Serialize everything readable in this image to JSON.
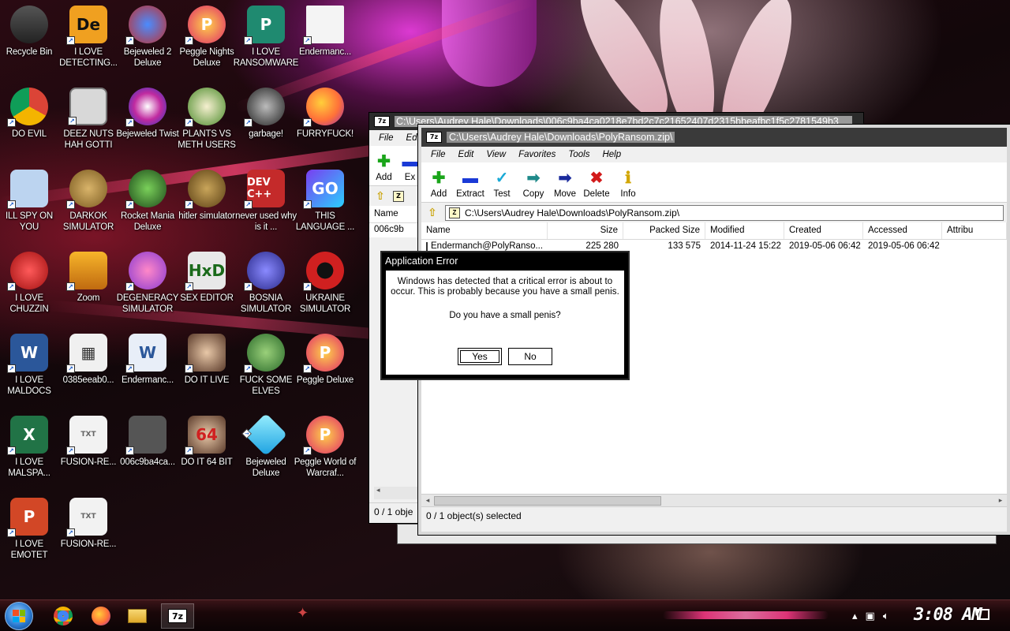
{
  "desktop": {
    "icons": [
      {
        "label": "Recycle Bin",
        "glyph": "trash-icon"
      },
      {
        "label": "I LOVE DETECTING...",
        "glyph": "de-icon"
      },
      {
        "label": "Bejeweled 2 Deluxe",
        "glyph": "bejeweled2-icon"
      },
      {
        "label": "Peggle Nights Deluxe",
        "glyph": "peggle-icon"
      },
      {
        "label": "I LOVE RANSOMWARE",
        "glyph": "publisher-icon"
      },
      {
        "label": "Endermanc...",
        "glyph": "blank-file-icon"
      },
      {
        "label": "DO EVIL",
        "glyph": "chrome-icon"
      },
      {
        "label": "DEEZ NUTS HAH GOTTI",
        "glyph": "windows-stack-icon"
      },
      {
        "label": "Bejeweled Twist",
        "glyph": "bejeweled-twist-icon"
      },
      {
        "label": "PLANTS VS METH USERS",
        "glyph": "plants-icon"
      },
      {
        "label": "garbage!",
        "glyph": "garbage-icon"
      },
      {
        "label": "FURRYFUCK!",
        "glyph": "firefox-icon"
      },
      {
        "label": "ILL SPY ON YOU",
        "glyph": "spy-icon"
      },
      {
        "label": "DARKOK SIMULATOR",
        "glyph": "moneybag-icon"
      },
      {
        "label": "Rocket Mania Deluxe",
        "glyph": "rocket-icon"
      },
      {
        "label": "hitler simulator",
        "glyph": "coin-icon"
      },
      {
        "label": "never used why is it ...",
        "glyph": "devcpp-icon"
      },
      {
        "label": "THIS LANGUAGE ...",
        "glyph": "goland-icon"
      },
      {
        "label": "I LOVE CHUZZIN",
        "glyph": "chuzzle-icon"
      },
      {
        "label": "Zoom",
        "glyph": "zoom-icon"
      },
      {
        "label": "DEGENERACY SIMULATOR",
        "glyph": "gender-icon"
      },
      {
        "label": "SEX EDITOR",
        "glyph": "hxd-icon"
      },
      {
        "label": "BOSNIA SIMULATOR",
        "glyph": "mine-icon"
      },
      {
        "label": "UKRAINE SIMULATOR",
        "glyph": "radiation-icon"
      },
      {
        "label": "I LOVE MALDOCS",
        "glyph": "word-icon"
      },
      {
        "label": "0385eeab0...",
        "glyph": "building-icon"
      },
      {
        "label": "Endermanc...",
        "glyph": "word-doc-icon"
      },
      {
        "label": "DO IT LIVE",
        "glyph": "portrait-icon"
      },
      {
        "label": "FUCK SOME ELVES",
        "glyph": "elf-icon"
      },
      {
        "label": "Peggle Deluxe",
        "glyph": "peggle-icon"
      },
      {
        "label": "I LOVE MALSPA...",
        "glyph": "excel-icon"
      },
      {
        "label": "FUSION-RE...",
        "glyph": "txt-file-icon"
      },
      {
        "label": "006c9ba4ca...",
        "glyph": "video-file-icon"
      },
      {
        "label": "DO IT 64 BIT",
        "glyph": "portrait64-icon"
      },
      {
        "label": "Bejeweled Deluxe",
        "glyph": "diamond-icon"
      },
      {
        "label": "Peggle World of Warcraf...",
        "glyph": "peggle-icon"
      },
      {
        "label": "I LOVE EMOTET",
        "glyph": "powerpoint-icon"
      },
      {
        "label": "FUSION-RE...",
        "glyph": "txt-file-icon"
      }
    ]
  },
  "back_window": {
    "title": "C:\\Users\\Audrey Hale\\Downloads\\006c9ba4ca0218e7bd2c7c21652407d2315bbeafbc1f5c2781549b3",
    "menu": [
      "File",
      "Edi"
    ],
    "toolbar": [
      "Add",
      "Ex"
    ],
    "col_name": "Name",
    "row": "006c9b",
    "status": "0 / 1 obje"
  },
  "front_window": {
    "title": "C:\\Users\\Audrey Hale\\Downloads\\PolyRansom.zip\\",
    "menu": [
      "File",
      "Edit",
      "View",
      "Favorites",
      "Tools",
      "Help"
    ],
    "toolbar": [
      {
        "label": "Add",
        "icon": "plus-icon",
        "color": "#1aa51a"
      },
      {
        "label": "Extract",
        "icon": "minus-icon",
        "color": "#1a3ad6"
      },
      {
        "label": "Test",
        "icon": "check-icon",
        "color": "#19a9d6"
      },
      {
        "label": "Copy",
        "icon": "copy-arrow-icon",
        "color": "#1f8a8a"
      },
      {
        "label": "Move",
        "icon": "move-arrow-icon",
        "color": "#1a2a9c"
      },
      {
        "label": "Delete",
        "icon": "x-icon",
        "color": "#d21a1a"
      },
      {
        "label": "Info",
        "icon": "info-icon",
        "color": "#d2a600"
      }
    ],
    "address": "C:\\Users\\Audrey Hale\\Downloads\\PolyRansom.zip\\",
    "columns": [
      "Name",
      "Size",
      "Packed Size",
      "Modified",
      "Created",
      "Accessed",
      "Attribu"
    ],
    "rows": [
      {
        "name": "Endermanch@PolyRanso...",
        "size": "225 280",
        "packed": "133 575",
        "modified": "2014-11-24 15:22",
        "created": "2019-05-06 06:42",
        "accessed": "2019-05-06 06:42"
      }
    ],
    "status": "0 / 1 object(s) selected"
  },
  "dialog": {
    "title": "Application Error",
    "message": "Windows has detected that a critical error is about to occur. This is probably because you have a small penis.",
    "question": "Do you have a small penis?",
    "yes": "Yes",
    "no": "No"
  },
  "taskbar": {
    "clock": "3:08 AM",
    "apps": [
      "chrome-icon",
      "firefox-icon",
      "explorer-icon",
      "7zip-icon"
    ],
    "seven_zip_label": "7z"
  },
  "colors": {
    "accent": "#ff3b8a",
    "dialog_bg": "#000000",
    "window_bg": "#f0f0f0"
  }
}
